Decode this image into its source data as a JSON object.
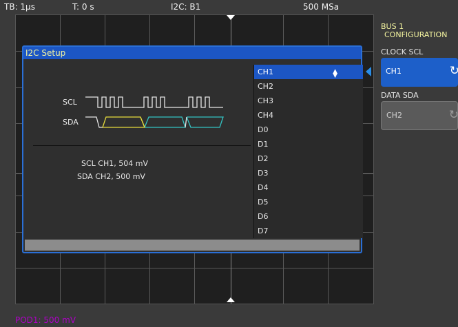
{
  "header": {
    "timebase": "TB: 1µs",
    "trigger_time": "T: 0 s",
    "bus": "I2C: B1",
    "sample_rate": "500 MSa"
  },
  "footer": {
    "pod_label": "POD1: 500 mV"
  },
  "dialog": {
    "title": "I2C Setup",
    "scl_label": "SCL",
    "sda_label": "SDA",
    "scl_info": "SCL  CH1, 504 mV",
    "sda_info": "SDA  CH2, 500 mV",
    "sources": [
      "CH1",
      "CH2",
      "CH3",
      "CH4",
      "D0",
      "D1",
      "D2",
      "D3",
      "D4",
      "D5",
      "D6",
      "D7"
    ],
    "selected_source": "CH1"
  },
  "sidebar": {
    "title_line1": "BUS 1",
    "title_line2": "CONFIGURATION",
    "clock_label": "CLOCK SCL",
    "clock_value": "CH1",
    "data_label": "DATA SDA",
    "data_value": "CH2"
  },
  "colors": {
    "accent": "#1c56c4",
    "sda_trace": "#e6dc3c",
    "sda_trace_2": "#33c4c4",
    "title_text": "#f5f5a0",
    "pod": "#b000c8"
  }
}
